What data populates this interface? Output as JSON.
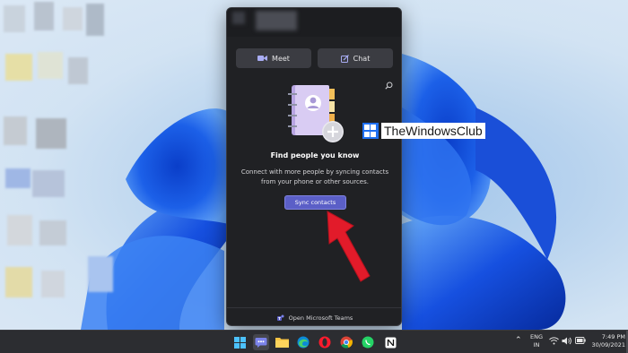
{
  "flyout": {
    "meet_label": "Meet",
    "chat_label": "Chat",
    "title": "Find people you know",
    "description": "Connect with more people by syncing contacts from your phone or other sources.",
    "sync_label": "Sync contacts",
    "footer_label": "Open Microsoft Teams"
  },
  "watermark": {
    "text": "TheWindowsClub"
  },
  "taskbar": {
    "pinned": [
      "windows-start",
      "teams-chat",
      "file-explorer",
      "edge",
      "opera",
      "chrome",
      "whatsapp",
      "notion"
    ],
    "lang_line1": "ENG",
    "lang_line2": "IN",
    "time": "7:49 PM",
    "date": "30/09/2021"
  },
  "colors": {
    "accent": "#5b5fc7",
    "flyout_bg": "#202124",
    "annotation_red": "#e21b2a",
    "taskbar_bg": "#2c2d31"
  }
}
